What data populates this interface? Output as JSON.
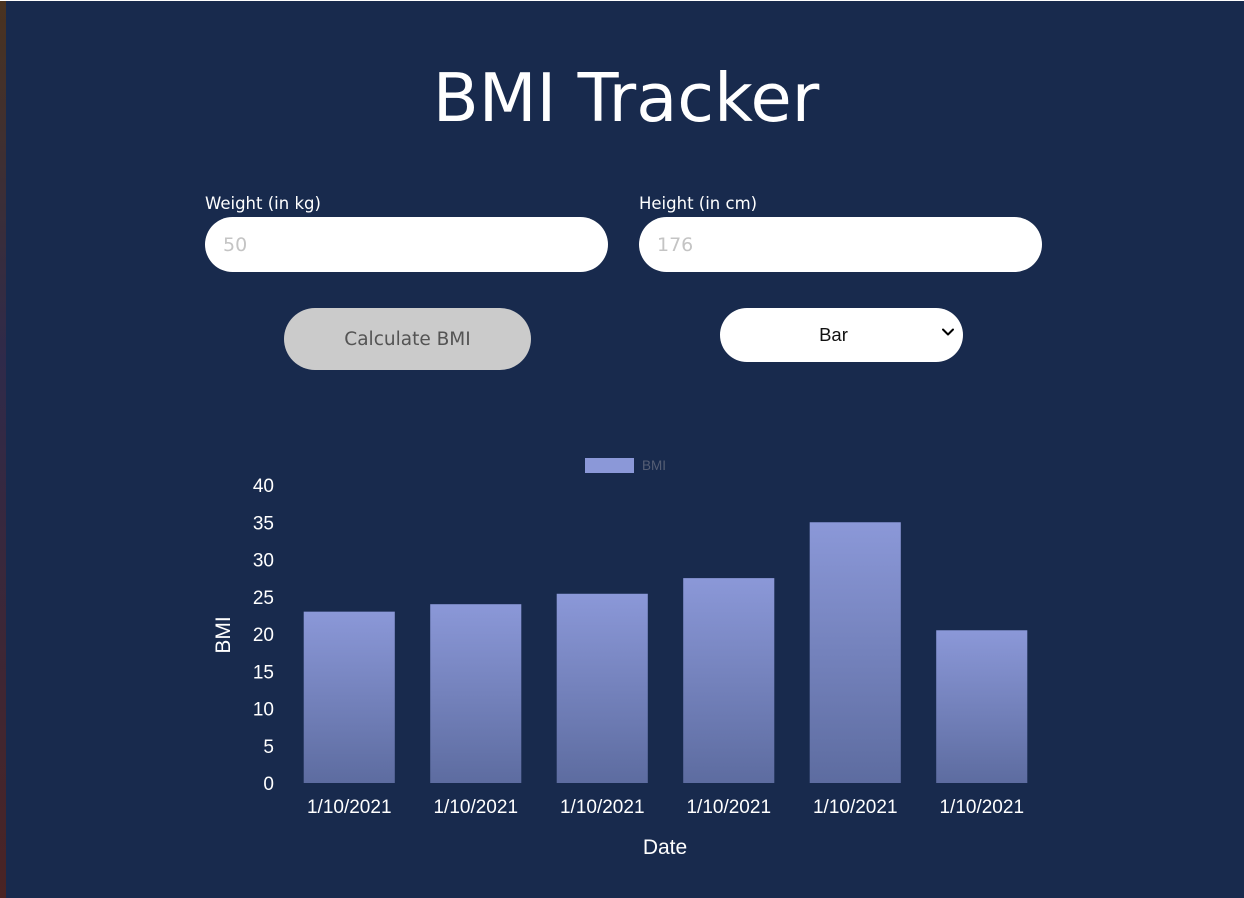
{
  "page": {
    "title": "BMI Tracker"
  },
  "form": {
    "weight": {
      "label": "Weight (in kg)",
      "placeholder": "50"
    },
    "height": {
      "label": "Height (in cm)",
      "placeholder": "176"
    },
    "calculate_label": "Calculate BMI",
    "chart_type": {
      "selected": "Bar"
    }
  },
  "colors": {
    "background": "#182a4d",
    "bar_top": "#8b98d8",
    "bar_bottom": "#5d6ca0",
    "legend_text": "#555e74",
    "button_bg": "#cbcbcb"
  },
  "icons": {
    "select_arrow": "chevron-down-icon"
  },
  "chart_data": {
    "type": "bar",
    "categories": [
      "1/10/2021",
      "1/10/2021",
      "1/10/2021",
      "1/10/2021",
      "1/10/2021",
      "1/10/2021"
    ],
    "series": [
      {
        "name": "BMI",
        "values": [
          23,
          24,
          25.4,
          27.5,
          35,
          20.5
        ]
      }
    ],
    "xlabel": "Date",
    "ylabel": "BMI",
    "ylim": [
      0,
      40
    ],
    "yticks": [
      0,
      5,
      10,
      15,
      20,
      25,
      30,
      35,
      40
    ],
    "grid": false,
    "legend": "top-center"
  }
}
